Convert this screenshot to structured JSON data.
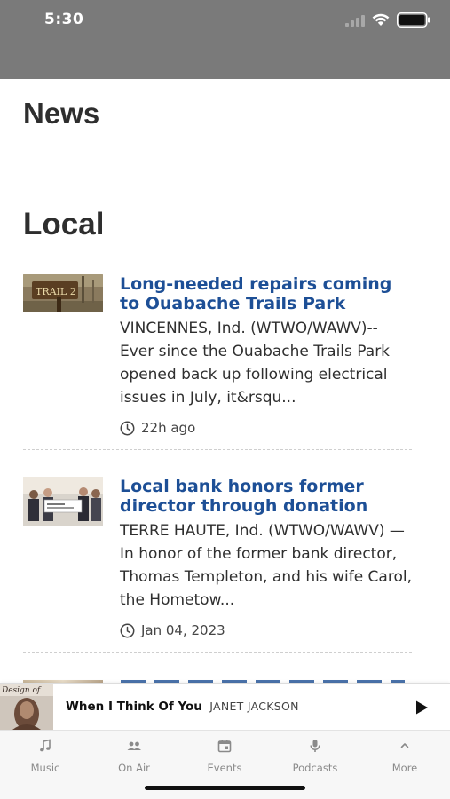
{
  "status_bar": {
    "time": "5:30"
  },
  "page": {
    "title": "News",
    "section_title": "Local"
  },
  "articles": [
    {
      "headline": "Long-needed repairs coming to Ouabache Trails Park",
      "excerpt": "VINCENNES, Ind. (WTWO/WAWV)-- Ever since the Ouabache Trails Park opened back up following electrical issues in July, it&rsqu...",
      "time": "22h ago",
      "thumb_text": "TRAIL 2"
    },
    {
      "headline": "Local bank honors former director through donation",
      "excerpt": "TERRE HAUTE, Ind. (WTWO/WAWV) — In honor of the former bank director, Thomas Templeton, and his wife Carol, the Hometow...",
      "time": "Jan 04, 2023"
    }
  ],
  "player": {
    "song": "When I Think Of You",
    "artist": "JANET JACKSON",
    "album_text": "Design of"
  },
  "tabs": [
    {
      "label": "Music",
      "icon": "music-note-icon"
    },
    {
      "label": "On Air",
      "icon": "people-icon"
    },
    {
      "label": "Events",
      "icon": "calendar-icon"
    },
    {
      "label": "Podcasts",
      "icon": "microphone-icon"
    },
    {
      "label": "More",
      "icon": "chevron-up-icon"
    }
  ],
  "colors": {
    "headline": "#1d4f96",
    "status_bar": "#7a7a7a",
    "tab_label": "#8a8a8a"
  }
}
